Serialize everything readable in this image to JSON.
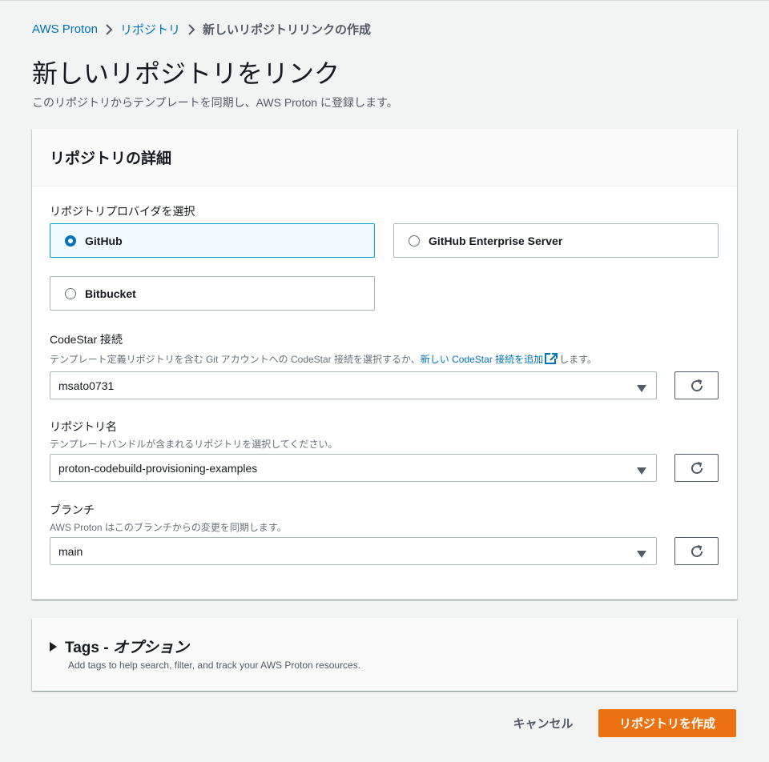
{
  "breadcrumb": {
    "items": [
      "AWS Proton",
      "リポジトリ",
      "新しいリポジトリリンクの作成"
    ]
  },
  "page": {
    "title": "新しいリポジトリをリンク",
    "description": "このリポジトリからテンプレートを同期し、AWS Proton に登録します。"
  },
  "details": {
    "title": "リポジトリの詳細",
    "provider": {
      "label": "リポジトリプロバイダを選択",
      "options": [
        "GitHub",
        "GitHub Enterprise Server",
        "Bitbucket"
      ],
      "selected": "GitHub"
    },
    "connection": {
      "label": "CodeStar 接続",
      "desc_prefix": "テンプレート定義リポジトリを含む Git アカウントへの CodeStar 接続を選択するか、",
      "desc_link": "新しい CodeStar 接続を追加",
      "desc_suffix": "します。",
      "value": "msato0731"
    },
    "repository": {
      "label": "リポジトリ名",
      "desc": "テンプレートバンドルが含まれるリポジトリを選択してください。",
      "value": "proton-codebuild-provisioning-examples"
    },
    "branch": {
      "label": "ブランチ",
      "desc": "AWS Proton はこのブランチからの変更を同期します。",
      "value": "main"
    }
  },
  "tags": {
    "title": "Tags - ",
    "title_optional": "オプション",
    "desc": "Add tags to help search, filter, and track your AWS Proton resources."
  },
  "actions": {
    "cancel": "キャンセル",
    "submit": "リポジトリを作成"
  },
  "icons": {
    "breadcrumb_separator": "chevron-right-icon",
    "external_link": "external-link-icon",
    "dropdown": "caret-down-icon",
    "refresh": "refresh-icon",
    "expand": "caret-right-icon"
  },
  "colors": {
    "link": "#0073bb",
    "primary_button": "#ec7211",
    "selected_tile_bg": "#f1faff",
    "selected_tile_border": "#00a1c9"
  }
}
